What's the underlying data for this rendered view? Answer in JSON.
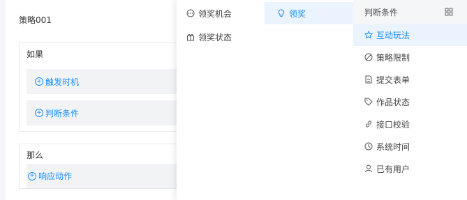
{
  "rule": {
    "title": "策略001",
    "if_label": "如果",
    "trigger_link": "触发时机",
    "condition_link": "判断条件",
    "then_label": "那么",
    "action_link": "响应动作"
  },
  "menu_col1": {
    "items": [
      {
        "label": "领奖机会",
        "icon": "circle-dots-icon"
      },
      {
        "label": "领奖状态",
        "icon": "gift-icon"
      }
    ]
  },
  "menu_col2": {
    "items": [
      {
        "label": "领奖",
        "icon": "bulb-icon",
        "active": true
      }
    ]
  },
  "menu_col3": {
    "header": "判断条件",
    "items": [
      {
        "label": "互动玩法",
        "icon": "star-icon",
        "active": true
      },
      {
        "label": "策略限制",
        "icon": "ban-icon"
      },
      {
        "label": "提交表单",
        "icon": "form-icon"
      },
      {
        "label": "作品状态",
        "icon": "tag-icon"
      },
      {
        "label": "接口校验",
        "icon": "link-icon"
      },
      {
        "label": "系统时间",
        "icon": "clock-icon"
      },
      {
        "label": "已有用户",
        "icon": "user-icon"
      }
    ]
  },
  "colors": {
    "accent": "#1890ff",
    "active_bg": "#eaf3fe"
  }
}
